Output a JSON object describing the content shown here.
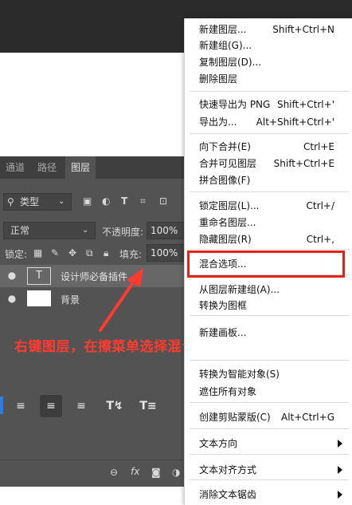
{
  "panel": {
    "tabs": [
      "通道",
      "路径",
      "图层"
    ],
    "active_tab": "图层",
    "filter_kind": "类型",
    "blend_mode": "正常",
    "opacity_label": "不透明度:",
    "opacity_value": "100%",
    "lock_label": "锁定:",
    "fill_label": "填充:",
    "fill_value": "100%",
    "layers": [
      {
        "name": "设计师必备插件",
        "type": "text",
        "thumb": "T",
        "selected": true
      },
      {
        "name": "背景",
        "type": "background",
        "selected": false
      }
    ],
    "footer_fx": "fx"
  },
  "annotation": {
    "text": "右键图层，在擦菜单选择混合选项",
    "color": "#ff3b2f"
  },
  "menu": {
    "groups": [
      [
        {
          "label": "新建图层...",
          "shortcut": "Shift+Ctrl+N"
        },
        {
          "label": "新建组(G)...",
          "shortcut": ""
        },
        {
          "label": "复制图层(D)...",
          "shortcut": ""
        },
        {
          "label": "删除图层",
          "shortcut": ""
        }
      ],
      [
        {
          "label": "快速导出为 PNG",
          "shortcut": "Shift+Ctrl+'"
        },
        {
          "label": "导出为...",
          "shortcut": "Alt+Shift+Ctrl+'"
        }
      ],
      [
        {
          "label": "向下合并(E)",
          "shortcut": "Ctrl+E"
        },
        {
          "label": "合并可见图层",
          "shortcut": "Shift+Ctrl+E"
        },
        {
          "label": "拼合图像(F)",
          "shortcut": ""
        }
      ],
      [
        {
          "label": "锁定图层(L)...",
          "shortcut": "Ctrl+/"
        },
        {
          "label": "重命名图层...",
          "shortcut": ""
        },
        {
          "label": "隐藏图层(R)",
          "shortcut": "Ctrl+,"
        }
      ],
      [
        {
          "label": "混合选项...",
          "shortcut": ""
        }
      ],
      [
        {
          "label": "从图层新建组(A)...",
          "shortcut": ""
        },
        {
          "label": "转换为图框",
          "shortcut": ""
        }
      ],
      [
        {
          "label": "新建画板...",
          "shortcut": ""
        }
      ],
      [
        {
          "label": "转换为智能对象(S)",
          "shortcut": ""
        },
        {
          "label": "遮住所有对象",
          "shortcut": ""
        }
      ],
      [
        {
          "label": "创建剪贴蒙版(C)",
          "shortcut": "Alt+Ctrl+G"
        }
      ],
      [
        {
          "label": "文本方向",
          "shortcut": "",
          "submenu": true
        }
      ],
      [
        {
          "label": "文本对齐方式",
          "shortcut": "",
          "submenu": true
        }
      ],
      [
        {
          "label": "消除文本锯齿",
          "shortcut": "",
          "submenu": true
        }
      ]
    ]
  },
  "colors": {
    "highlight": "#e32218",
    "panel_bg": "#535353",
    "accent": "#2c7be5"
  }
}
